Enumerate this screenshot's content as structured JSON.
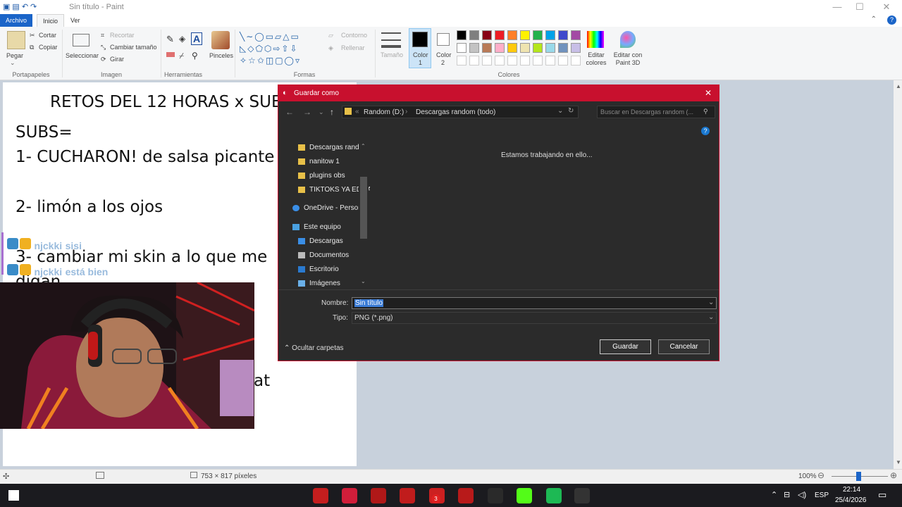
{
  "window": {
    "title": "Sin título - Paint"
  },
  "tabs": {
    "file": "Archivo",
    "home": "Inicio",
    "view": "Ver"
  },
  "ribbon": {
    "clipboard": {
      "paste": "Pegar",
      "cut": "Cortar",
      "copy": "Copiar",
      "label": "Portapapeles"
    },
    "image": {
      "select": "Seleccionar",
      "crop": "Recortar",
      "resize": "Cambiar tamaño",
      "rotate": "Girar",
      "label": "Imagen"
    },
    "tools": {
      "label": "Herramientas",
      "brushes": "Pinceles"
    },
    "shapes": {
      "outline": "Contorno",
      "fill": "Rellenar",
      "label": "Formas"
    },
    "size": "Tamaño",
    "color1": "Color",
    "color1_num": "1",
    "color2": "Color",
    "color2_num": "2",
    "edit_colors": "Editar colores",
    "edit_paint3d": "Editar con Paint 3D",
    "colors_label": "Colores",
    "palette": [
      "#000000",
      "#7f7f7f",
      "#880015",
      "#ed1c24",
      "#ff7f27",
      "#fff200",
      "#22b14c",
      "#00a2e8",
      "#3f48cc",
      "#a349a4",
      "#ffffff",
      "#c3c3c3",
      "#b97a57",
      "#ffaec9",
      "#ffc90e",
      "#efe4b0",
      "#b5e61d",
      "#99d9ea",
      "#7092be",
      "#c8bfe7"
    ]
  },
  "canvas_text": {
    "line1": "RETOS DEL 12 HORAS x SUB",
    "line2": "SUBS=",
    "line3": "1- CUCHARON! de salsa picante",
    "line4": "2- limón a los ojos",
    "line5": "3- cambiar mi skin a lo que me",
    "line6": "digan",
    "line7": "at"
  },
  "chat": [
    {
      "user": "njckki",
      "msg": "sisi"
    },
    {
      "user": "njckki",
      "msg": "está bien"
    }
  ],
  "dialog": {
    "title": "Guardar como",
    "breadcrumb": [
      "Random (D:)",
      "Descargas random (todo)"
    ],
    "search_placeholder": "Buscar en Descargas random (...",
    "nav_items": [
      {
        "label": "Descargas random",
        "icon": "folder-icon"
      },
      {
        "label": "nanitow 1",
        "icon": "folder-icon"
      },
      {
        "label": "plugins obs",
        "icon": "folder-icon"
      },
      {
        "label": "TIKTOKS YA EDITADOS",
        "icon": "folder-icon"
      },
      {
        "label": "OneDrive - Personal",
        "icon": "onedrive-icon"
      },
      {
        "label": "Este equipo",
        "icon": "computer-icon"
      },
      {
        "label": "Descargas",
        "icon": "download-icon"
      },
      {
        "label": "Documentos",
        "icon": "documents-icon"
      },
      {
        "label": "Escritorio",
        "icon": "desktop-icon"
      },
      {
        "label": "Imágenes",
        "icon": "pictures-icon"
      }
    ],
    "loading_text": "Estamos trabajando en ello...",
    "name_label": "Nombre:",
    "name_value": "Sin título",
    "type_label": "Tipo:",
    "type_value": "PNG (*.png)",
    "hide_folders": "Ocultar carpetas",
    "save": "Guardar",
    "cancel": "Cancelar"
  },
  "status": {
    "dimensions": "753 × 817 píxeles",
    "zoom": "100%"
  },
  "taskbar": {
    "lang": "ESP",
    "time": "22:14",
    "date": "25/4/2026",
    "badge": "3",
    "apps": [
      {
        "name": "app-red-1",
        "color": "#c41e1e"
      },
      {
        "name": "opera-gx",
        "color": "#d11e3a"
      },
      {
        "name": "amd-software",
        "color": "#b01818"
      },
      {
        "name": "app-check",
        "color": "#c01c1c"
      },
      {
        "name": "app-folder",
        "color": "#cc2020"
      },
      {
        "name": "app-red-2",
        "color": "#b81a1a"
      },
      {
        "name": "app-clock",
        "color": "#2a2a2a"
      },
      {
        "name": "kick",
        "color": "#53fc18"
      },
      {
        "name": "spotify",
        "color": "#1db954"
      },
      {
        "name": "paint",
        "color": "#333333"
      }
    ]
  }
}
